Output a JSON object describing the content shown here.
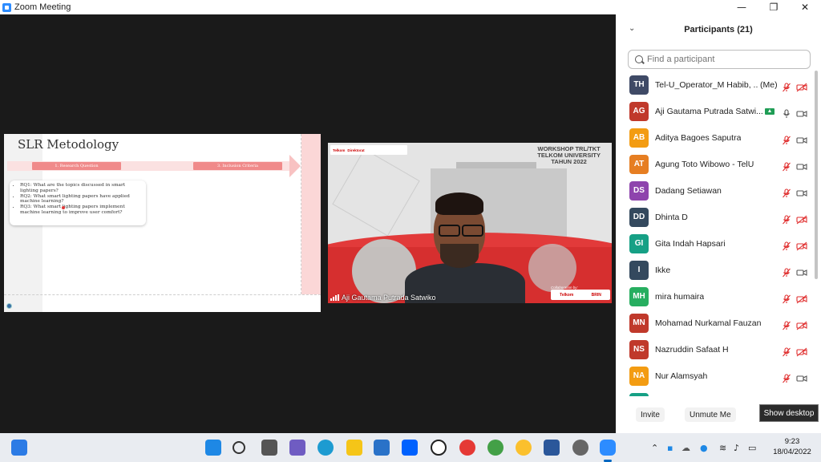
{
  "window": {
    "title": "Zoom Meeting",
    "minimize": "—",
    "maximize": "❐",
    "close": "✕"
  },
  "slide": {
    "title": "SLR Metodology",
    "steps": [
      "1. Research Question",
      "3. Inclusion Criteria"
    ],
    "questions": [
      "RQ1: What are the topics discussed in smart lighting papers?",
      "RQ2: What smart lighting papers have applied machine learning?",
      "RQ3: What smart lighting papers implement machine learning to improve user comfort?"
    ]
  },
  "video": {
    "participant_name": "Aji Gautama Putrada Satwiko",
    "workshop": [
      "WORKSHOP TRL/TKT",
      "TELKOM UNIVERSITY",
      "TAHUN 2022"
    ],
    "logos": [
      "Telkom",
      "Direktorat"
    ],
    "collab_label": "Collaboration by:",
    "collab_logos": [
      "Telkom",
      "BRIN"
    ]
  },
  "participants_panel": {
    "title": "Participants (21)",
    "search_placeholder": "Find a participant",
    "me_label": "(Me)",
    "participants": [
      {
        "initials": "TH",
        "name": "Tel-U_Operator_M Habib, ...",
        "color": "#3f4a66",
        "mic": "muted",
        "video": "off",
        "me": true
      },
      {
        "initials": "AG",
        "name": "Aji Gautama Putrada Satwi...",
        "color": "#c0392b",
        "mic": "on",
        "video": "on",
        "sharing": true
      },
      {
        "initials": "AB",
        "name": "Aditya Bagoes Saputra",
        "color": "#f39c12",
        "mic": "muted",
        "video": "on"
      },
      {
        "initials": "AT",
        "name": "Agung Toto Wibowo - TelU",
        "color": "#e67e22",
        "mic": "muted",
        "video": "on"
      },
      {
        "initials": "DS",
        "name": "Dadang Setiawan",
        "color": "#8e44ad",
        "mic": "muted",
        "video": "on"
      },
      {
        "initials": "DD",
        "name": "Dhinta D",
        "color": "#34495e",
        "mic": "muted",
        "video": "off"
      },
      {
        "initials": "GI",
        "name": "Gita Indah Hapsari",
        "color": "#16a085",
        "mic": "muted",
        "video": "off"
      },
      {
        "initials": "I",
        "name": "Ikke",
        "color": "#34495e",
        "mic": "muted",
        "video": "on"
      },
      {
        "initials": "MH",
        "name": "mira humaira",
        "color": "#27ae60",
        "mic": "muted",
        "video": "off"
      },
      {
        "initials": "MN",
        "name": "Mohamad Nurkamal Fauzan",
        "color": "#c0392b",
        "mic": "muted",
        "video": "off"
      },
      {
        "initials": "NS",
        "name": "Nazruddin Safaat H",
        "color": "#c0392b",
        "mic": "muted",
        "video": "off"
      },
      {
        "initials": "NA",
        "name": "Nur Alamsyah",
        "color": "#f39c12",
        "mic": "muted",
        "video": "on"
      }
    ],
    "buttons": {
      "invite": "Invite",
      "unmute": "Unmute Me"
    }
  },
  "tooltip": "Show desktop",
  "taskbar": {
    "time": "9:23",
    "date": "18/04/2022",
    "apps": [
      "start-icon",
      "search-icon",
      "task-view-icon",
      "chat-icon",
      "edge-icon",
      "file-explorer-icon",
      "mail-icon",
      "dropbox-icon",
      "github-icon",
      "chrome-icon",
      "chrome-icon",
      "chrome-icon",
      "word-icon",
      "settings-icon",
      "zoom-icon"
    ]
  },
  "colors": {
    "accent": "#2d8cff",
    "muted": "#e02f2f",
    "slide_accent": "#f08a8a"
  }
}
